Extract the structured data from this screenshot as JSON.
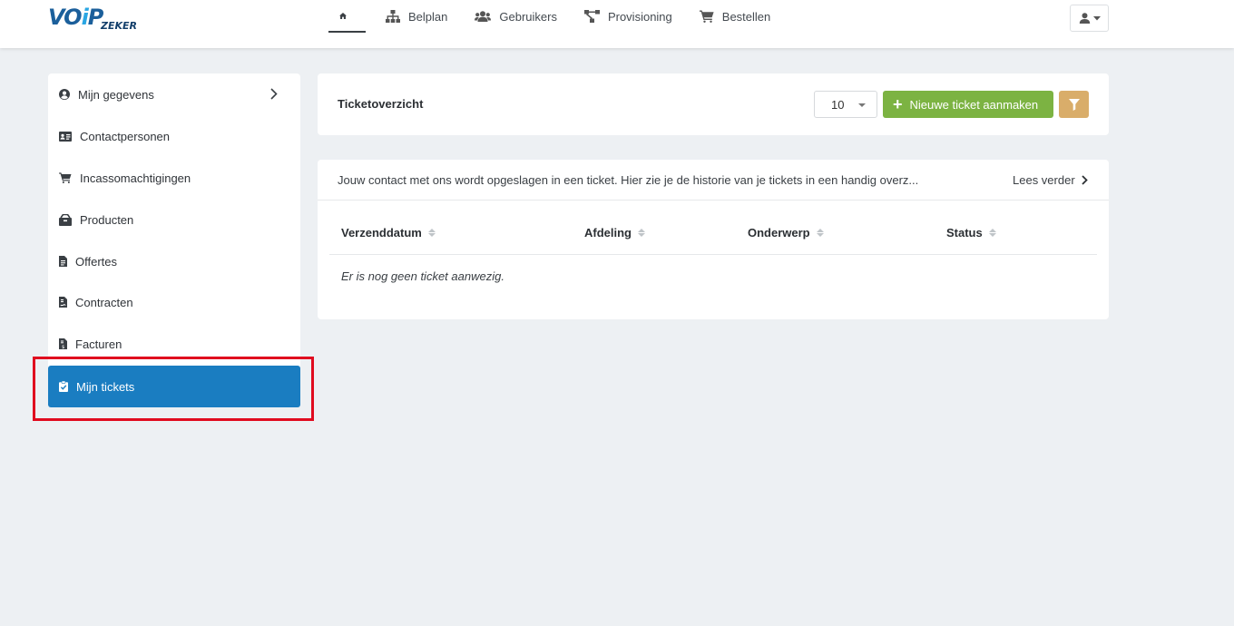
{
  "logo": {
    "main": "VOiP",
    "main_v": "VO",
    "main_i": "i",
    "main_p": "P",
    "sub": "ZEKER"
  },
  "nav": {
    "items": [
      {
        "label": "Belplan",
        "icon": "sitemap-icon"
      },
      {
        "label": "Gebruikers",
        "icon": "users-icon"
      },
      {
        "label": "Provisioning",
        "icon": "network-icon"
      },
      {
        "label": "Bestellen",
        "icon": "cart-icon"
      }
    ]
  },
  "sidebar": {
    "items": [
      {
        "label": "Mijn gegevens",
        "icon": "user-circle-icon"
      },
      {
        "label": "Contactpersonen",
        "icon": "id-card-icon"
      },
      {
        "label": "Incassomachtigingen",
        "icon": "cart-icon"
      },
      {
        "label": "Producten",
        "icon": "box-icon"
      },
      {
        "label": "Offertes",
        "icon": "file-icon"
      },
      {
        "label": "Contracten",
        "icon": "file-contract-icon"
      },
      {
        "label": "Facturen",
        "icon": "file-invoice-icon"
      },
      {
        "label": "Mijn tickets",
        "icon": "clipboard-check-icon",
        "active": true
      }
    ]
  },
  "tickets": {
    "title": "Ticketoverzicht",
    "page_size": "10",
    "new_button": "Nieuwe ticket aanmaken",
    "info_text": "Jouw contact met ons wordt opgeslagen in een ticket. Hier zie je de historie van je tickets in een handig overz...",
    "read_more": "Lees verder",
    "columns": [
      "Verzenddatum",
      "Afdeling",
      "Onderwerp",
      "Status"
    ],
    "empty_message": "Er is nog geen ticket aanwezig."
  },
  "colors": {
    "accent": "#1a7dc1",
    "new_button": "#7cb342",
    "filter_button": "#d9ad6a",
    "highlight": "#e00b1f"
  }
}
